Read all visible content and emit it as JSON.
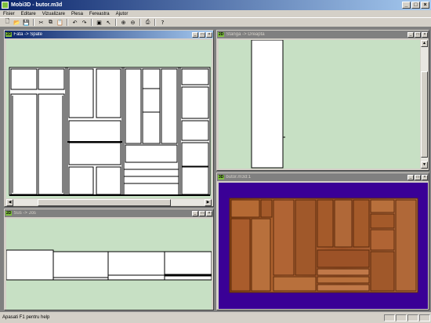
{
  "app": {
    "title": "Mobi3D - butor.m3d"
  },
  "window_buttons": [
    "_",
    "□",
    "×"
  ],
  "menu": [
    "Fisier",
    "Editare",
    "Vizualizare",
    "Piesa",
    "Fereastra",
    "Ajutor"
  ],
  "toolbar": [
    {
      "name": "new-file-icon",
      "glyph": "🗋"
    },
    {
      "name": "open-folder-icon",
      "glyph": "📂"
    },
    {
      "name": "save-icon",
      "glyph": "💾"
    },
    {
      "sep": true
    },
    {
      "name": "cut-icon",
      "glyph": "✂"
    },
    {
      "name": "copy-icon",
      "glyph": "⧉"
    },
    {
      "name": "paste-icon",
      "glyph": "📋"
    },
    {
      "sep": true
    },
    {
      "name": "undo-icon",
      "glyph": "↶"
    },
    {
      "name": "redo-icon",
      "glyph": "↷"
    },
    {
      "sep": true
    },
    {
      "name": "add-piece-icon",
      "glyph": "▣"
    },
    {
      "name": "select-pointer-icon",
      "glyph": "↖"
    },
    {
      "sep": true
    },
    {
      "name": "zoom-in-icon",
      "glyph": "⊕"
    },
    {
      "name": "zoom-out-icon",
      "glyph": "⊖"
    },
    {
      "sep": true
    },
    {
      "name": "print-icon",
      "glyph": "⎙"
    },
    {
      "sep": true
    },
    {
      "name": "help-icon",
      "glyph": "?"
    }
  ],
  "windows": {
    "front": {
      "badge": "2D",
      "title": "Fata -> Spate"
    },
    "side": {
      "badge": "2D",
      "title": "Stanga -> Dreapta"
    },
    "top": {
      "badge": "2D",
      "title": "Sus -> Jos"
    },
    "view3d": {
      "badge": "3D",
      "title": "butor.m3d:1"
    }
  },
  "child_buttons": [
    "_",
    "□",
    "×"
  ],
  "colors": {
    "canvas_bg": "#c7e0c4",
    "view3d_bg": "#3a0096",
    "wood": "#a0522d",
    "title_active": "#0a246a"
  },
  "status": {
    "text": "Apasati F1 pentru help"
  }
}
